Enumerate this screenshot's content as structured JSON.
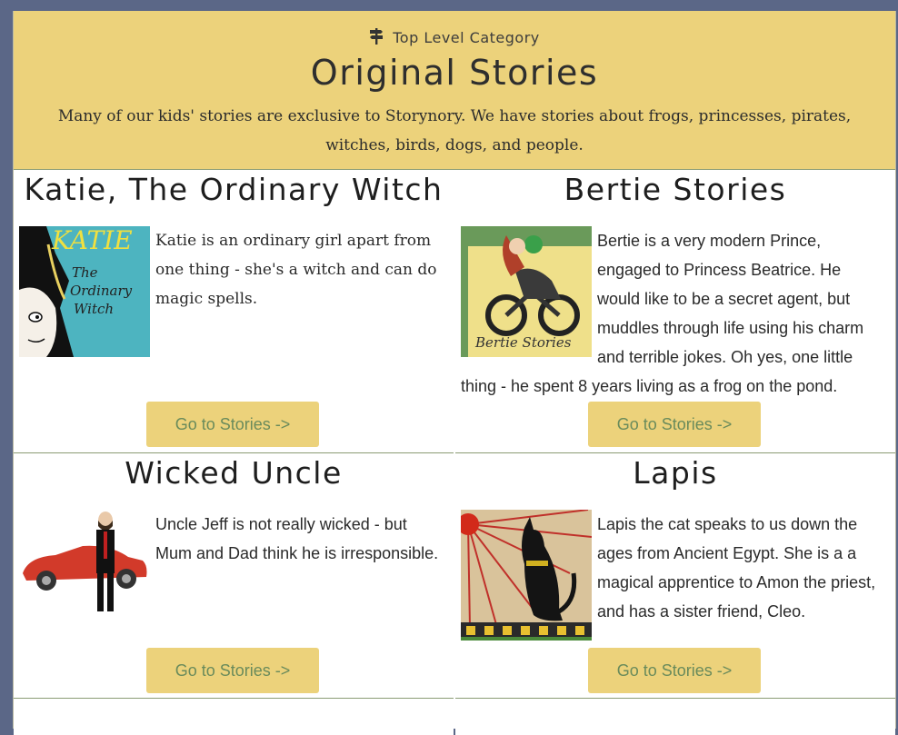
{
  "header": {
    "crumb_icon": "signpost-icon",
    "crumb": "Top Level Category",
    "title": "Original Stories",
    "description": "Many of our kids' stories are exclusive to Storynory. We have stories about frogs, princesses, pirates, witches, birds, dogs, and people."
  },
  "cards": [
    {
      "title": "Katie, The Ordinary Witch",
      "image_text": [
        "KATIE",
        "The",
        "Ordinary",
        "Witch"
      ],
      "text": "Katie is an ordinary girl apart from one thing - she's a witch and can do magic spells.",
      "button": "Go to Stories ->"
    },
    {
      "title": "Bertie Stories",
      "image_text": "Bertie Stories",
      "text": "Bertie is a very modern Prince, engaged to Princess Beatrice. He would like to be a secret agent, but muddles through life using his charm and terrible jokes. Oh yes, one little thing - he spent 8 years living as a frog on the pond.",
      "button": "Go to Stories ->"
    },
    {
      "title": "Wicked Uncle",
      "text": "Uncle Jeff is not really wicked - but Mum and Dad think he is irresponsible.",
      "button": "Go to Stories ->"
    },
    {
      "title": "Lapis",
      "text": "Lapis the cat speaks to us down the ages from Ancient Egypt. She is a a magical apprentice to Amon the priest, and has a sister friend, Cleo.",
      "button": "Go to Stories ->"
    }
  ],
  "colors": {
    "background": "#5b6787",
    "header": "#ecd27b",
    "button": "#ecd27b",
    "button_text": "#6a8b5b",
    "divider": "#8a9b73"
  }
}
